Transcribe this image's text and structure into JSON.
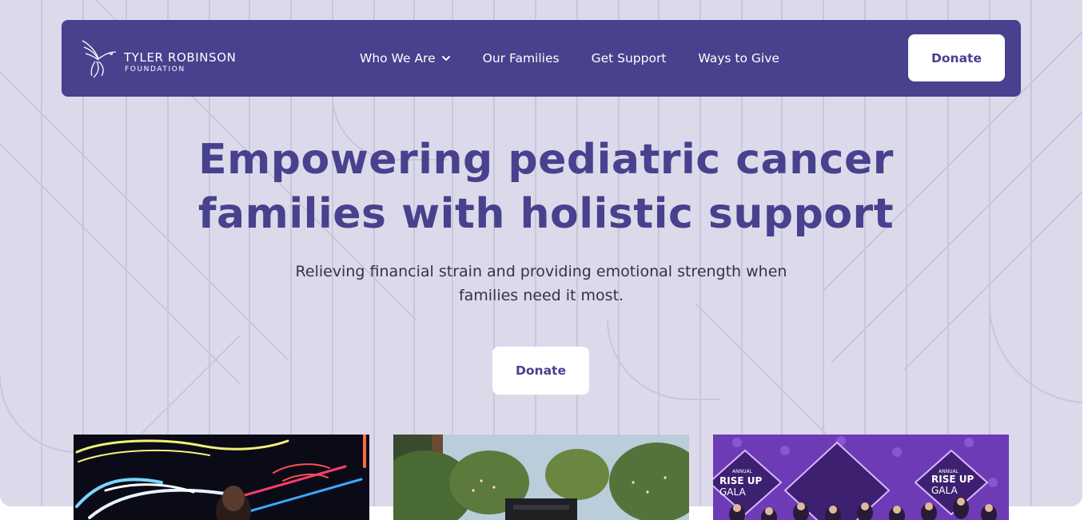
{
  "brand": {
    "name_line1": "TYLER ROBINSON",
    "name_line2": "FOUNDATION"
  },
  "nav": {
    "items": [
      {
        "label": "Who We Are",
        "has_dropdown": true
      },
      {
        "label": "Our Families"
      },
      {
        "label": "Get Support"
      },
      {
        "label": "Ways to Give"
      }
    ],
    "donate_label": "Donate"
  },
  "hero": {
    "title": "Empowering pediatric cancer families with holistic support",
    "subtitle": "Relieving financial strain and providing emotional strength when families need it most.",
    "donate_label": "Donate"
  },
  "cards": [
    {
      "image": "neon-sign-event-photo"
    },
    {
      "image": "outdoor-trees-truck-photo"
    },
    {
      "image": "rise-up-gala-stage-photo",
      "sign_text": [
        "ANNUAL",
        "RISE UP",
        "GALA"
      ]
    }
  ],
  "colors": {
    "brand_purple": "#47418e",
    "hero_background": "#dcdaea",
    "text_dark": "#333342",
    "white": "#ffffff"
  }
}
